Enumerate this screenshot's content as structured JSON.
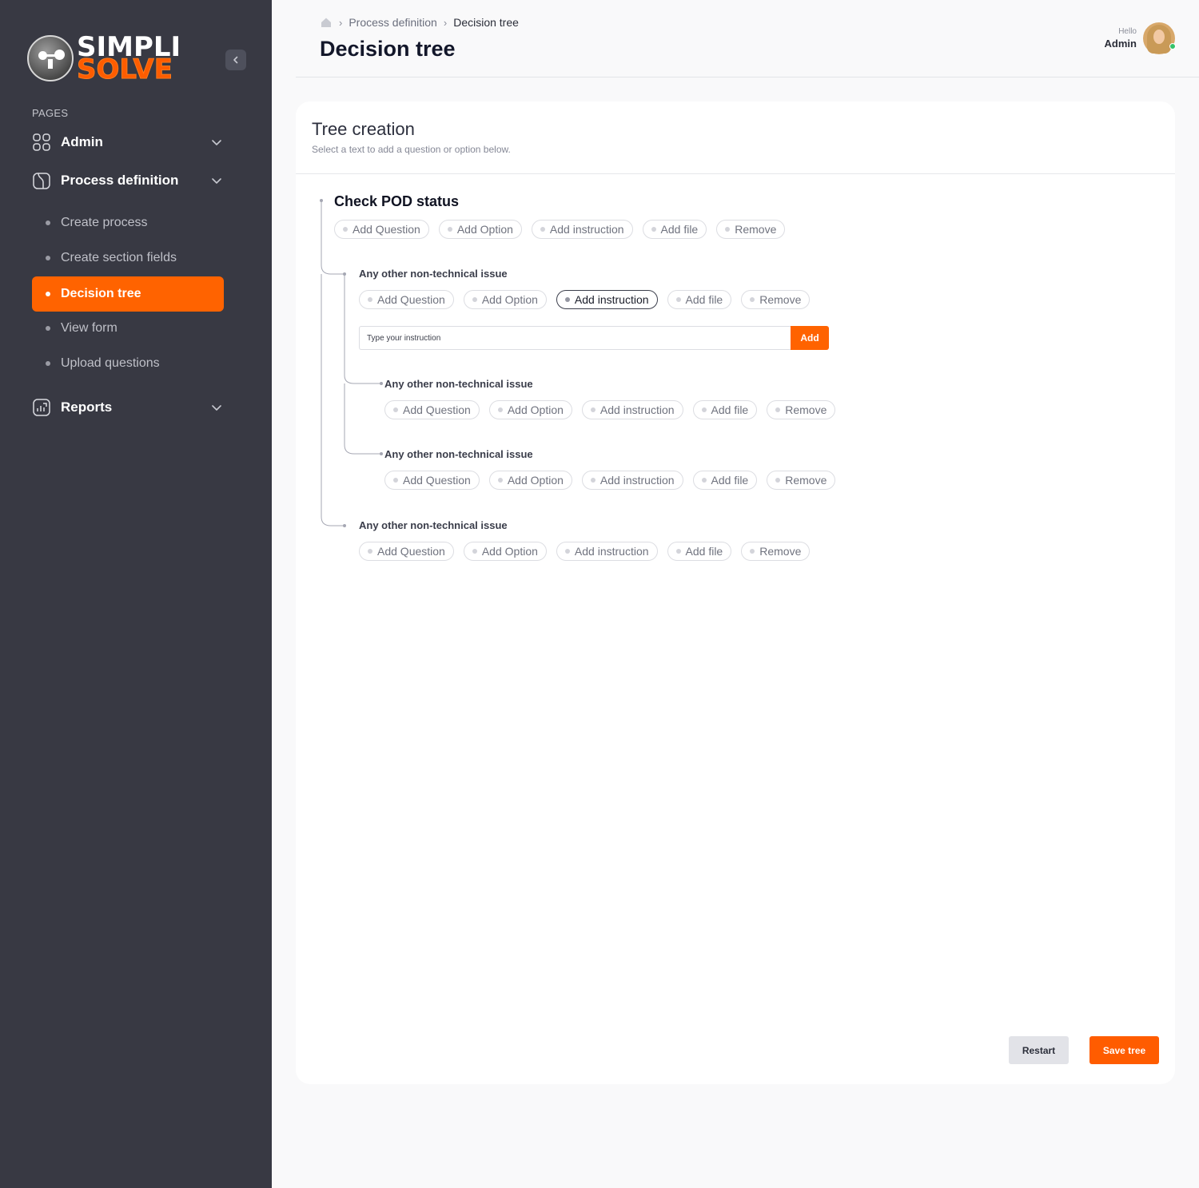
{
  "brand": {
    "line1": "SIMPLI",
    "line2": "SOLVE",
    "accent": "#ff6300"
  },
  "sidebar": {
    "section_label": "PAGES",
    "groups": [
      {
        "label": "Admin",
        "icon": "grid-icon"
      },
      {
        "label": "Process definition",
        "icon": "document-icon"
      },
      {
        "label": "Reports",
        "icon": "chart-icon"
      }
    ],
    "process_items": [
      {
        "label": "Create process"
      },
      {
        "label": "Create section fields"
      },
      {
        "label": "Decision tree",
        "active": true
      },
      {
        "label": "View form"
      },
      {
        "label": "Upload questions"
      }
    ]
  },
  "header": {
    "breadcrumb": [
      "Process definition",
      "Decision tree"
    ],
    "title": "Decision tree",
    "greeting": "Hello",
    "user": "Admin"
  },
  "card": {
    "title": "Tree creation",
    "subtitle": "Select a text to add a question or option below."
  },
  "actions": [
    "Add Question",
    "Add Option",
    "Add instruction",
    "Add file",
    "Remove"
  ],
  "tree": {
    "root": "Check POD status",
    "node_1": "Any other non-technical issue",
    "node_1_1": "Any other non-technical issue",
    "node_1_2": "Any other non-technical issue",
    "node_2": "Any other non-technical issue"
  },
  "instruction": {
    "placeholder": "Type your instruction",
    "add_label": "Add"
  },
  "footer": {
    "restart": "Restart",
    "save": "Save tree"
  }
}
